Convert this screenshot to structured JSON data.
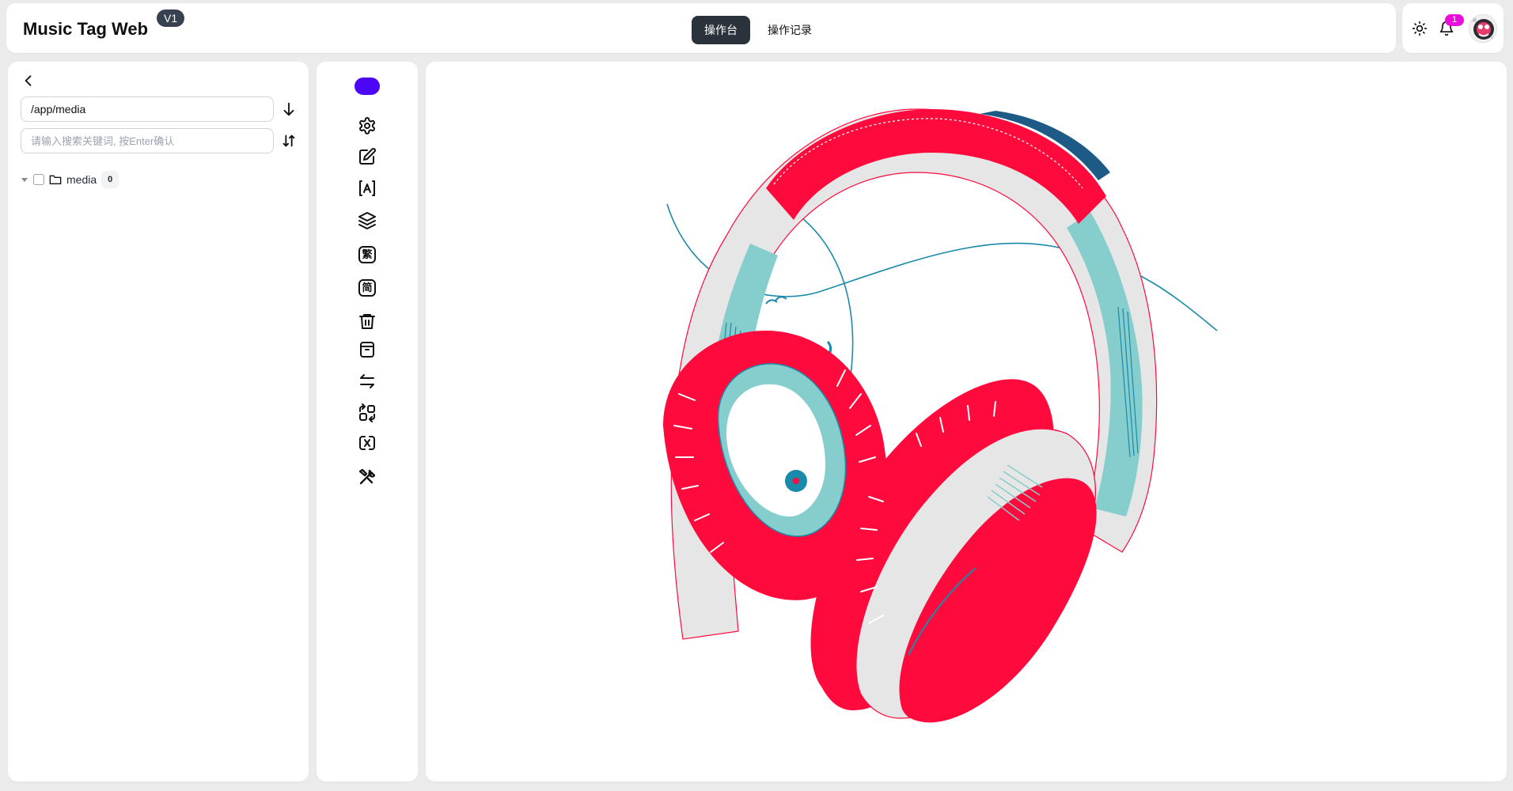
{
  "header": {
    "title": "Music Tag Web",
    "version": "V1",
    "tabs": [
      {
        "label": "操作台",
        "active": true
      },
      {
        "label": "操作记录",
        "active": false
      }
    ],
    "notifications_count": "1",
    "icons": [
      "sun-icon",
      "bell-icon",
      "avatar"
    ]
  },
  "left_panel": {
    "path_value": "/app/media",
    "search_placeholder": "请输入搜索关键词, 按Enter确认",
    "tree": [
      {
        "label": "media",
        "count": "0"
      }
    ]
  },
  "toolbar": {
    "accent_color": "#4b06f5",
    "traditional_char": "繁",
    "simplified_char": "简",
    "icons": [
      "settings-icon",
      "edit-icon",
      "text-recognize-icon",
      "layers-icon",
      "traditional-chinese-icon",
      "simplified-chinese-icon",
      "trash-icon",
      "archive-icon",
      "swap-icon",
      "shapes-convert-icon",
      "link-broken-icon",
      "tools-icon"
    ]
  },
  "colors": {
    "primary_red": "#ff0a3c",
    "teal": "#86cdcd",
    "dark_teal": "#1a8aaa",
    "gray": "#e7e6e6",
    "notify_badge": "#e90ed9",
    "active_tab": "#2a323c"
  }
}
